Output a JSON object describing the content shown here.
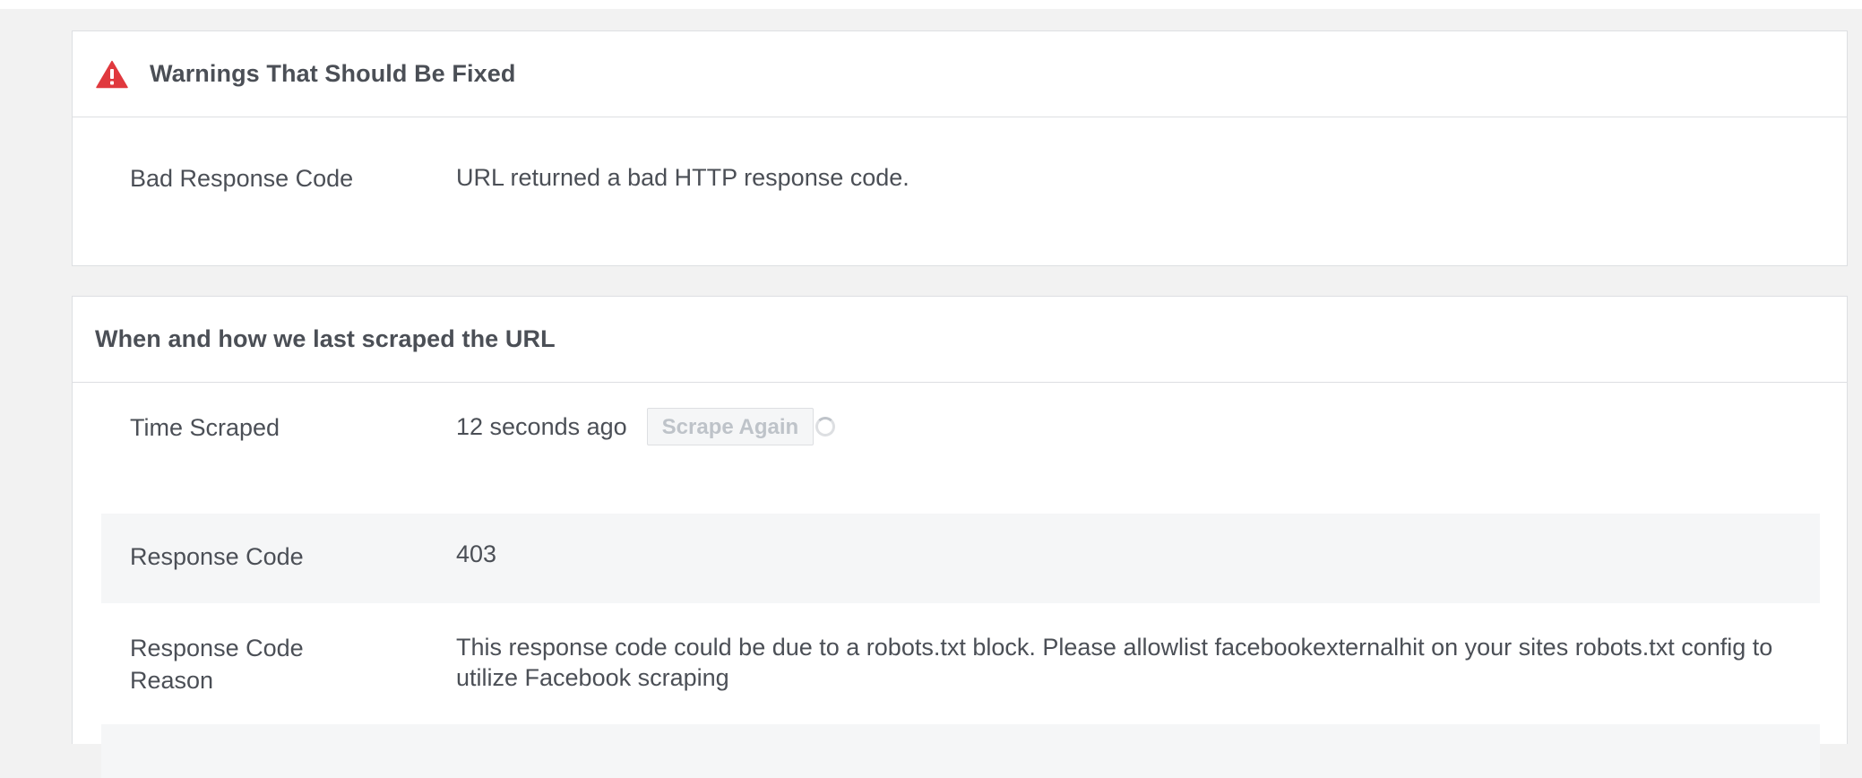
{
  "warnings": {
    "title": "Warnings That Should Be Fixed",
    "icon": "warning-triangle-icon",
    "icon_color": "#e0393e",
    "items": [
      {
        "label": "Bad Response Code",
        "value": "URL returned a bad HTTP response code."
      }
    ]
  },
  "scrape": {
    "title": "When and how we last scraped the URL",
    "time_scraped": {
      "label": "Time Scraped",
      "value": "12 seconds ago",
      "button_label": "Scrape Again"
    },
    "response_code": {
      "label": "Response Code",
      "value": "403"
    },
    "response_code_reason": {
      "label_line1": "Response Code",
      "label_line2": "Reason",
      "value": "This response code could be due to a robots.txt block. Please allowlist facebookexternalhit on your sites robots.txt config to utilize Facebook scraping"
    }
  },
  "colors": {
    "page_background": "#f2f2f2",
    "panel_background": "#ffffff",
    "border": "#dddfe2",
    "alt_row": "#f5f6f7",
    "text": "#4b4f56",
    "disabled_text": "#bec3c9"
  }
}
